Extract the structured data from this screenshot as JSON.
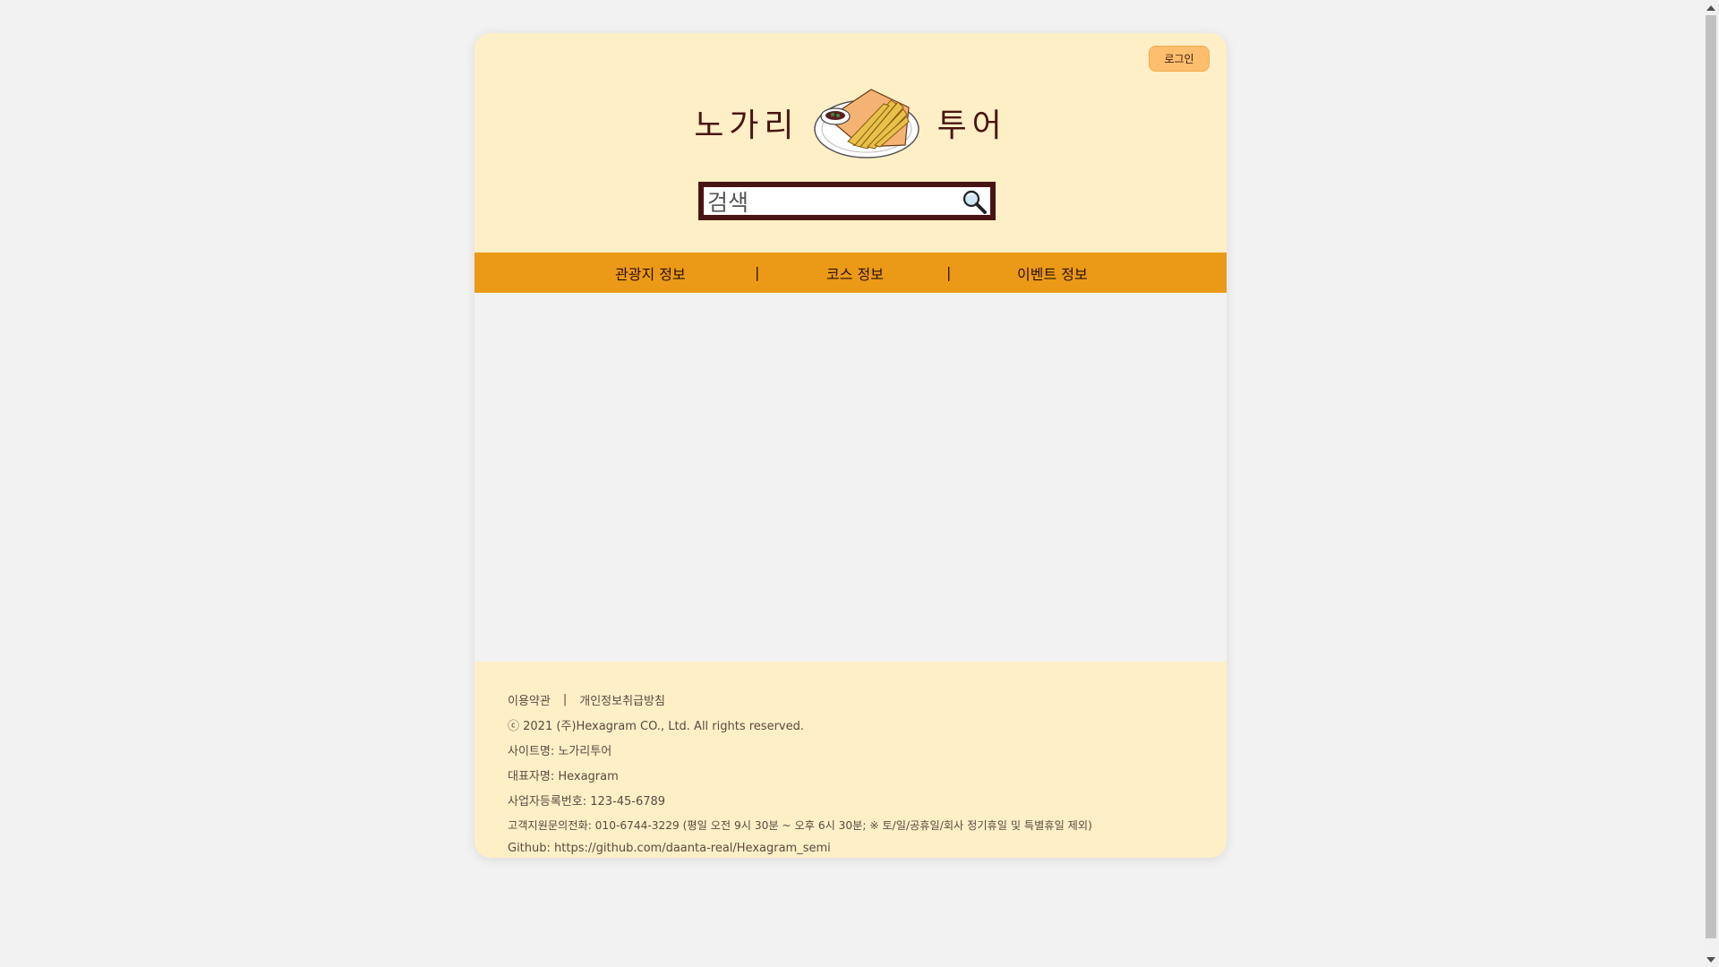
{
  "header": {
    "login_label": "로그인",
    "logo_left": "노가리",
    "logo_right": "투어",
    "search_placeholder": "검색"
  },
  "nav": {
    "items": [
      {
        "label": "관광지 정보"
      },
      {
        "label": "코스 정보"
      },
      {
        "label": "이벤트 정보"
      }
    ],
    "separator": "|"
  },
  "footer": {
    "links": [
      "이용약관",
      "개인정보취급방침"
    ],
    "link_separator": "|",
    "lines": [
      "ⓒ 2021 (주)Hexagram CO., Ltd. All rights reserved.",
      "사이트명: 노가리투어",
      "대표자명: Hexagram",
      "사업자등록번호: 123-45-6789",
      "고객지원문의전화: 010-6744-3229 (평일 오전 9시 30분 ~ 오후 6시 30분; ※ 토/일/공휴일/회사 정기휴일 및 특별휴일 제외)",
      "Github: https://github.com/daanta-real/Hexagram_semi"
    ]
  },
  "colors": {
    "page_bg": "#f2f2f2",
    "header_bg": "#ffefc7",
    "nav_bg": "#eb9a17",
    "login_bg": "#ffbe6e",
    "logo_text": "#4a1410",
    "search_border": "#4a1414"
  },
  "icons": {
    "search": "magnifier-icon",
    "logo": "dried-fish-plate-icon"
  }
}
